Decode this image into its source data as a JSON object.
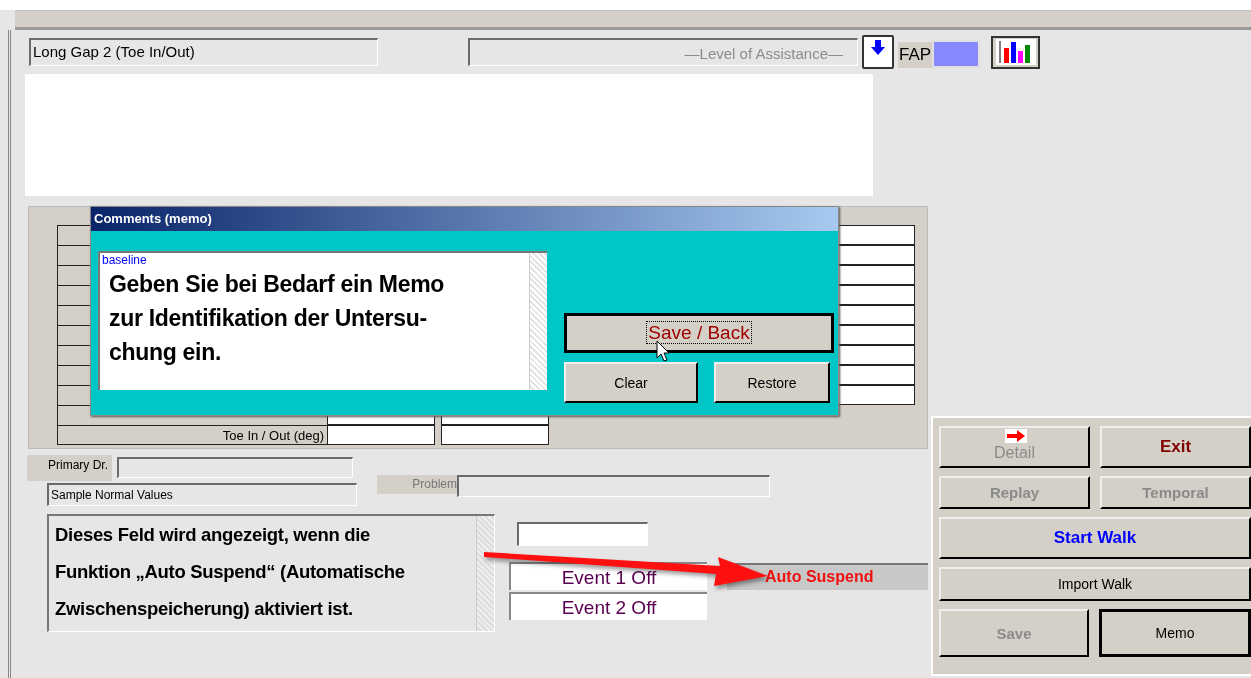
{
  "header": {
    "title_field": "Long Gap 2 (Toe In/Out)",
    "assistance_field": "—Level of Assistance—",
    "fap_label": "FAP"
  },
  "table": {
    "rows": [
      {
        "label": "Toe In / Out (deg)"
      }
    ]
  },
  "comments_dialog": {
    "title": "Comments (memo)",
    "memo_label": "baseline",
    "memo_text": "Geben Sie bei Bedarf ein Memo\nzur Identifikation der Untersu-\nchung ein.",
    "buttons": [
      {
        "label": "Save / Back",
        "kind": "large",
        "focused": true
      },
      {
        "label": "Clear",
        "kind": "small",
        "focused": false
      },
      {
        "label": "Restore",
        "kind": "small",
        "focused": false
      }
    ]
  },
  "primary_dr_label": "Primary Dr.",
  "normal_values_field": "Sample Normal Values",
  "problem_label": "Problem",
  "callout_text": "Dieses Feld wird angezeigt, wenn die\nFunktion „Auto Suspend“ (Automatische\nZwischenspeicherung) aktiviert ist.",
  "events": [
    "Event 1 Off",
    "Event 2 Off"
  ],
  "auto_suspend": "Auto Suspend",
  "panel_rows": [
    [
      {
        "label": "Detail",
        "kind": "detail",
        "disabled": true,
        "default": false
      },
      {
        "label": "Exit",
        "kind": "exit",
        "disabled": false,
        "default": false
      }
    ],
    [
      {
        "label": "Replay",
        "kind": "action",
        "disabled": true,
        "default": false
      },
      {
        "label": "Temporal",
        "kind": "action",
        "disabled": true,
        "default": false
      }
    ],
    [
      {
        "label": "Start Walk",
        "kind": "start",
        "disabled": false,
        "default": false
      }
    ],
    [
      {
        "label": "Import Walk",
        "kind": "plain",
        "disabled": false,
        "default": false
      }
    ],
    [
      {
        "label": "Save",
        "kind": "action",
        "disabled": true,
        "default": false
      },
      {
        "label": "Memo",
        "kind": "plain",
        "disabled": false,
        "default": true
      }
    ]
  ]
}
